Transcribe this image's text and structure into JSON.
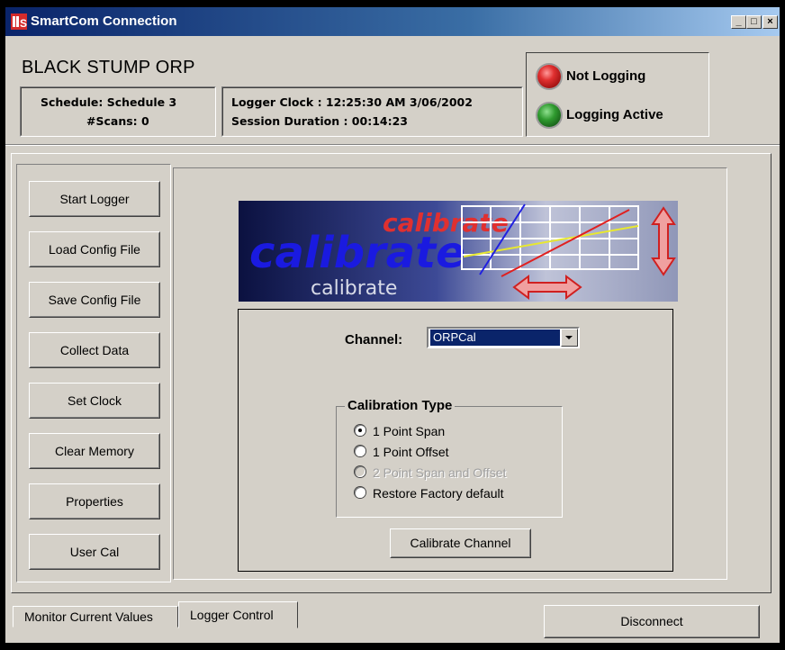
{
  "window": {
    "title": "SmartCom Connection",
    "minimize": "_",
    "maximize": "□",
    "close": "×"
  },
  "header": {
    "site_name": "BLACK STUMP ORP",
    "schedule": "Schedule: Schedule 3",
    "scans": "#Scans: 0",
    "logger_clock": "Logger Clock : 12:25:30 AM 3/06/2002",
    "session_duration": "Session Duration : 00:14:23"
  },
  "status": {
    "not_logging": {
      "label": "Not Logging",
      "color": "#d42020"
    },
    "logging_active": {
      "label": "Logging Active",
      "color": "#2f8a2f"
    }
  },
  "sidebar": {
    "buttons": [
      "Start Logger",
      "Load Config File",
      "Save Config File",
      "Collect Data",
      "Set Clock",
      "Clear Memory",
      "Properties",
      "User Cal"
    ]
  },
  "banner": {
    "words": [
      "calibrate",
      "calibrate",
      "calibrate"
    ]
  },
  "calibration": {
    "channel_label": "Channel:",
    "channel_value": "ORPCal",
    "type_label": "Calibration Type",
    "options": [
      {
        "label": "1 Point Span",
        "selected": true,
        "enabled": true
      },
      {
        "label": "1 Point Offset",
        "selected": false,
        "enabled": true
      },
      {
        "label": "2 Point Span and Offset",
        "selected": false,
        "enabled": false
      },
      {
        "label": "Restore Factory default",
        "selected": false,
        "enabled": true
      }
    ],
    "calibrate_button": "Calibrate Channel"
  },
  "tabs": [
    {
      "label": "Monitor Current Values",
      "active": false
    },
    {
      "label": "Logger Control",
      "active": true
    }
  ],
  "disconnect_button": "Disconnect"
}
